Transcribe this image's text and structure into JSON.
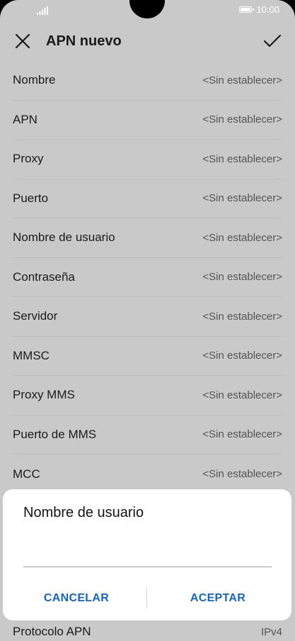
{
  "status_bar": {
    "time": "10:00"
  },
  "app_bar": {
    "title": "APN nuevo"
  },
  "fields": [
    {
      "label": "Nombre",
      "value": "<Sin establecer>"
    },
    {
      "label": "APN",
      "value": "<Sin establecer>"
    },
    {
      "label": "Proxy",
      "value": "<Sin establecer>"
    },
    {
      "label": "Puerto",
      "value": "<Sin establecer>"
    },
    {
      "label": "Nombre de usuario",
      "value": "<Sin establecer>"
    },
    {
      "label": "Contraseña",
      "value": "<Sin establecer>"
    },
    {
      "label": "Servidor",
      "value": "<Sin establecer>"
    },
    {
      "label": "MMSC",
      "value": "<Sin establecer>"
    },
    {
      "label": "Proxy MMS",
      "value": "<Sin establecer>"
    },
    {
      "label": "Puerto de MMS",
      "value": "<Sin establecer>"
    },
    {
      "label": "MCC",
      "value": "<Sin establecer>"
    }
  ],
  "dialog": {
    "title": "Nombre de usuario",
    "input_value": "",
    "cancel_label": "CANCELAR",
    "accept_label": "ACEPTAR"
  },
  "bottom_field": {
    "label": "Protocolo APN",
    "value": "IPv4"
  },
  "colors": {
    "accent": "#1565c0",
    "overlay_background": "#c9c9c9"
  }
}
